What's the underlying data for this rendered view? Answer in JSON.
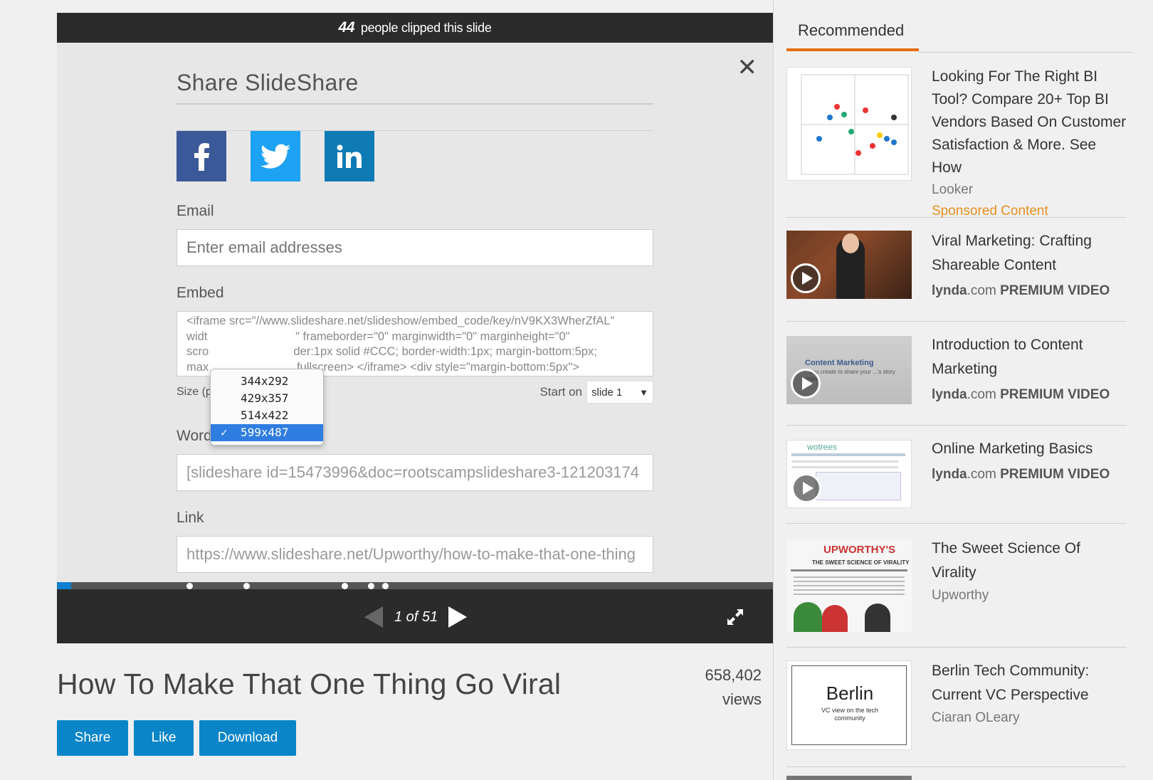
{
  "player": {
    "clip_count": "44",
    "clip_text": "people clipped this slide",
    "page_info": "1 of 51"
  },
  "share": {
    "title": "Share SlideShare",
    "social": [
      "facebook-icon",
      "twitter-icon",
      "linkedin-icon"
    ],
    "email_label": "Email",
    "email_placeholder": "Enter email addresses",
    "embed_label": "Embed",
    "embed_lines": [
      "<iframe src=\"//www.slideshare.net/slideshow/embed_code/key/nV9KX3WherZfAL\"",
      "widt                           \" frameborder=\"0\" marginwidth=\"0\" marginheight=\"0\"",
      "scro                          der:1px solid #CCC; border-width:1px; margin-bottom:5px;",
      "max                           fullscreen> </iframe> <div style=\"margin-bottom:5px\">"
    ],
    "size_label": "Size (p",
    "start_on_label": "Start on",
    "start_on_value": "slide 1",
    "size_options": [
      "344x292",
      "429x357",
      "514x422",
      "599x487"
    ],
    "size_selected": "599x487",
    "wp_label": "WordPress Shortcode",
    "wp_value": "[slideshare id=15473996&doc=rootscampslideshare3-121203174",
    "link_label": "Link",
    "link_value": "https://www.slideshare.net/Upworthy/how-to-make-that-one-thing"
  },
  "deck": {
    "title": "How To Make That One Thing Go Viral",
    "views_count": "658,402",
    "views_label": "views",
    "share_label": "Share",
    "like_label": "Like",
    "download_label": "Download"
  },
  "sidebar": {
    "tab_label": "Recommended",
    "items": [
      {
        "title": "Looking For The Right BI Tool? Compare 20+ Top BI Vendors Based On Customer Satisfaction & More. See How",
        "author": "Looker",
        "sponsored": "Sponsored Content"
      },
      {
        "title": "Viral Marketing: Crafting Shareable Content",
        "source_a": "lynda",
        "source_b": ".com",
        "source_c": "PREMIUM VIDEO"
      },
      {
        "title": "Introduction to Content Marketing",
        "source_a": "lynda",
        "source_b": ".com",
        "source_c": "PREMIUM VIDEO",
        "thumb_text": "Content Marketing",
        "thumb_sub": "...you create to share your ...'s story online"
      },
      {
        "title": "Online Marketing Basics",
        "source_a": "lynda",
        "source_b": ".com",
        "source_c": "PREMIUM VIDEO",
        "thumb_text": "wotrees"
      },
      {
        "title": "The Sweet Science Of Virality",
        "author": "Upworthy",
        "thumb_text": "UPWORTHY'S",
        "thumb_sub": "THE SWEET SCIENCE OF VIRALITY"
      },
      {
        "title": "Berlin Tech Community: Current VC Perspective",
        "author": "Ciaran OLeary",
        "thumb_text": "Berlin",
        "thumb_sub": "VC view on the tech community"
      }
    ]
  },
  "colors": {
    "accent_orange": "#e66c13",
    "button_blue": "#0a85c8",
    "facebook": "#3b5998",
    "twitter": "#1da1f2",
    "linkedin": "#0f7bb5",
    "dark_bar": "#2b2b2b"
  }
}
